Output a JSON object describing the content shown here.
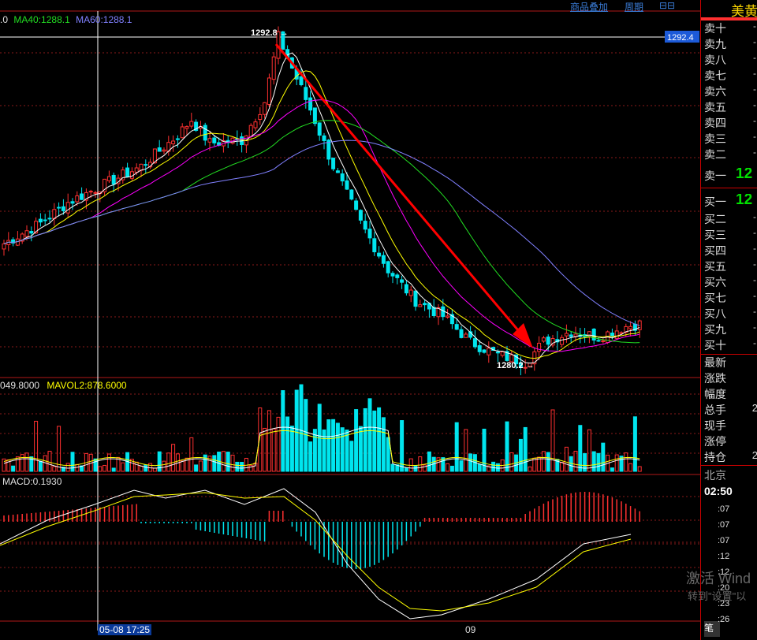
{
  "toolbar": {
    "overlay_label": "商品叠加",
    "period_label": "周期",
    "nav_label": "⊟⊟"
  },
  "legends": {
    "ma": [
      {
        "label": ".0",
        "color": "#e0e0e0"
      },
      {
        "label": "MA40:1288.1",
        "color": "#22dd22"
      },
      {
        "label": "MA60:1288.1",
        "color": "#8080ff"
      }
    ],
    "vol": [
      {
        "label": "049.8000",
        "color": "#e0e0e0"
      },
      {
        "label": "MAVOL2:878.6000",
        "color": "#ffff00"
      }
    ],
    "macd": {
      "label": "MACD:0.1930",
      "color": "#e0e0e0"
    }
  },
  "price": {
    "current_label": "1292.4",
    "high_label": "1292.8",
    "low_label": "1280.2",
    "high": 1292.8,
    "low": 1280.2
  },
  "crosshair": {
    "time_label": "05-08 17:25"
  },
  "x_axis": {
    "labels": [
      "09"
    ]
  },
  "orderbook": {
    "title": "美黄",
    "asks": [
      "卖十",
      "卖九",
      "卖八",
      "卖七",
      "卖六",
      "卖五",
      "卖四",
      "卖三",
      "卖二"
    ],
    "ask1": {
      "label": "卖一",
      "value": "12"
    },
    "bid1": {
      "label": "买一",
      "value": "12"
    },
    "bids": [
      "买二",
      "买三",
      "买四",
      "买五",
      "买六",
      "买七",
      "买八",
      "买九",
      "买十"
    ],
    "dash": "-",
    "stats": [
      {
        "label": "最新",
        "value": ""
      },
      {
        "label": "涨跌",
        "value": ""
      },
      {
        "label": "幅度",
        "value": ""
      },
      {
        "label": "总手",
        "value": "2"
      },
      {
        "label": "现手",
        "value": ""
      },
      {
        "label": "涨停",
        "value": ""
      },
      {
        "label": "持仓",
        "value": "2"
      }
    ],
    "market": "北京",
    "time": "02:50",
    "ticks": [
      ":07",
      ":07",
      ":07",
      ":12",
      ":12",
      ":20",
      ":23",
      ":26"
    ],
    "footer": "笔"
  },
  "watermark": {
    "line1": "激活 Wind",
    "line2": "转到\"设置\"以"
  },
  "colors": {
    "up": "#ff3030",
    "down": "#00e5ee",
    "ma5": "#ffffff",
    "ma10": "#ffff00",
    "ma20": "#ff00ff",
    "ma40": "#22dd22",
    "ma60": "#8080ff",
    "arrow": "#ff0000"
  },
  "chart_data": {
    "type": "candlestick",
    "series": [
      {
        "name": "MA40",
        "values": [
          1288.1
        ]
      },
      {
        "name": "MA60",
        "values": [
          1288.1
        ]
      },
      {
        "name": "MACD",
        "values": [
          0.193
        ]
      },
      {
        "name": "MAVOL2",
        "values": [
          878.6
        ]
      }
    ],
    "price_range": [
      1280.2,
      1292.8
    ],
    "grid": true
  }
}
